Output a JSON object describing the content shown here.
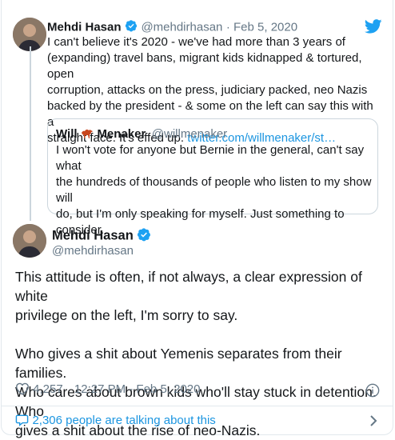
{
  "parent": {
    "name": "Mehdi Hasan",
    "handle": "@mehdirhasan",
    "date": "· Feb 5, 2020",
    "lines": [
      "I can't believe it's 2020 - we've had more than 3 years of",
      "(expanding) travel bans, migrant kids kidnapped & tortured, open",
      "corruption, attacks on the press, judiciary packed, neo Nazis",
      "backed by the president - & some on the left can say this with a"
    ],
    "last_line": "straight face. It's effed up.",
    "link": "twitter.com/willmenaker/st…"
  },
  "quote": {
    "name_first": "Will",
    "name_last": "Menaker",
    "handle": "@willmenaker",
    "lines": [
      "I won't vote for anyone but Bernie in the general, can't say what",
      "the hundreds of thousands of people who listen to my show will",
      "do, but I'm  only speaking for myself. Just something to",
      "consider."
    ]
  },
  "main": {
    "name": "Mehdi Hasan",
    "handle": "@mehdirhasan",
    "para1": [
      "This attitude is often, if not always, a clear expression of white",
      "privilege on the left, I'm sorry to say."
    ],
    "para2": [
      "Who gives a shit about Yemenis separates from their families.",
      "Who cares about brown kids who'll stay stuck in detention. Who",
      "gives a shit about the rise of neo-Nazis."
    ],
    "likes": "4,257",
    "timestamp": "12:27 PM - Feb 5, 2020"
  },
  "footer": {
    "talking": "2,306 people are talking about this"
  },
  "colors": {
    "twitter_blue": "#1da1f2",
    "link_blue": "#1b95e0",
    "gray": "#657786"
  }
}
